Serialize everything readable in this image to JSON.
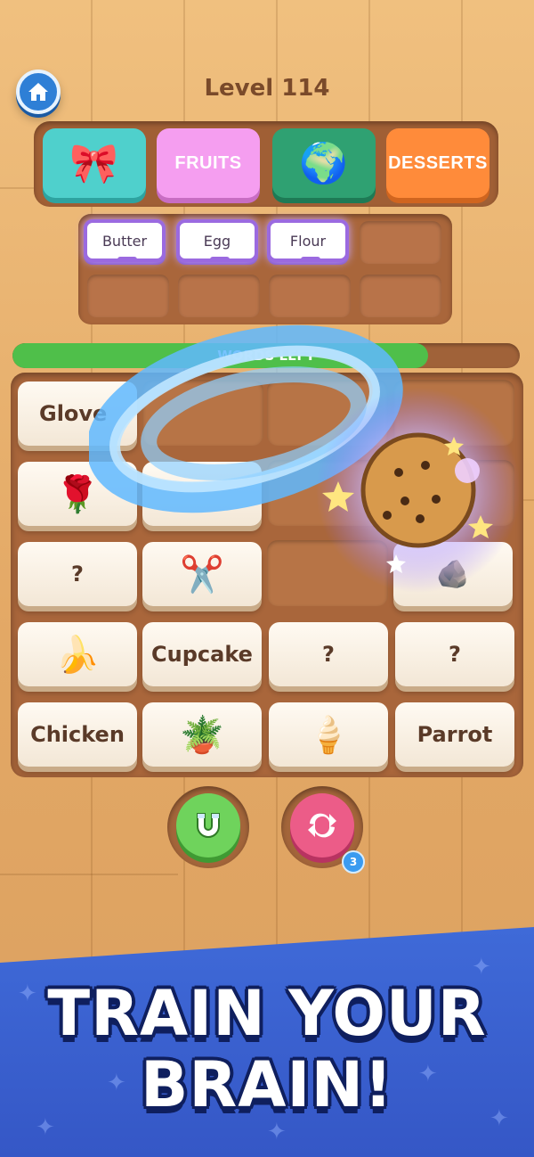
{
  "header": {
    "level_label": "Level 114"
  },
  "categories": [
    {
      "label": "",
      "icon": "bow-icon",
      "glyph": "🎀"
    },
    {
      "label": "FRUITS"
    },
    {
      "label": "",
      "icon": "globe-icon",
      "glyph": "🌍"
    },
    {
      "label": "DESSERTS"
    }
  ],
  "slots": [
    "Butter",
    "Egg",
    "Flour"
  ],
  "progress": {
    "text": "WORDS LEFT",
    "fraction": 0.82,
    "color": "#4fbf4a"
  },
  "board": {
    "row1": {
      "c1": "Glove"
    },
    "row2": {
      "c1_icon": "rose-icon",
      "c1_glyph": "🌹"
    },
    "row3": {
      "c1": "?",
      "c2_icon": "scissors-icon",
      "c2_glyph": "✂️",
      "c4_icon": "stone-icon",
      "c4_glyph": "🪨"
    },
    "row4": {
      "c1_icon": "banana-icon",
      "c1_glyph": "🍌",
      "c2": "Cupcake",
      "c3": "?",
      "c4": "?"
    },
    "row5": {
      "c1": "Chicken",
      "c2_icon": "potted-plant-icon",
      "c2_glyph": "🪴",
      "c3_icon": "ice-cream-icon",
      "c3_glyph": "🍦",
      "c4": "Parrot"
    }
  },
  "effect": {
    "icon": "cookie-icon",
    "glyph": "🍪"
  },
  "powerups": {
    "magnet_icon": "magnet-icon",
    "shuffle_icon": "shuffle-icon",
    "shuffle_count": "3"
  },
  "banner": {
    "line1": "TRAIN YOUR",
    "line2": "BRAIN!"
  },
  "colors": {
    "accent_purple": "#9b6ae0",
    "banner_blue": "#3f6ad8",
    "wood": "#a9663b"
  }
}
